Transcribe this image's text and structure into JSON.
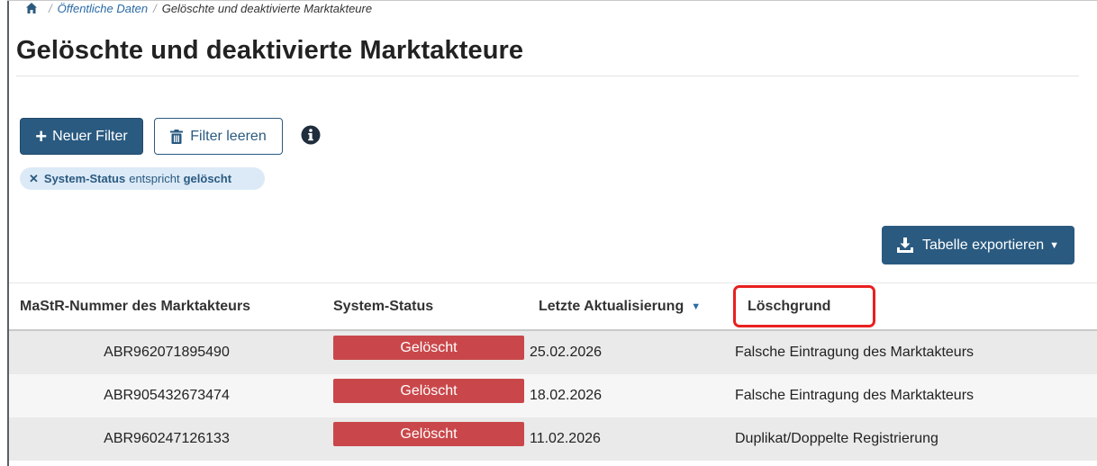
{
  "breadcrumb": {
    "home_icon": "home-icon",
    "items": [
      "Öffentliche Daten",
      "Gelöschte und deaktivierte Marktakteure"
    ]
  },
  "page": {
    "title": "Gelöschte und deaktivierte Marktakteure"
  },
  "toolbar": {
    "new_filter_label": "Neuer Filter",
    "clear_filter_label": "Filter leeren",
    "info_icon": "info-icon"
  },
  "active_filter": {
    "field": "System-Status",
    "operator": "entspricht",
    "value": "gelöscht"
  },
  "export": {
    "label": "Tabelle exportieren"
  },
  "table": {
    "columns": [
      "MaStR-Nummer des Marktakteurs",
      "System-Status",
      "Letzte Aktualisierung",
      "Löschgrund"
    ],
    "sort_column": "Letzte Aktualisierung",
    "sort_direction": "descending",
    "rows": [
      {
        "nummer": "ABR962071895490",
        "status": "Gelöscht",
        "datum": "25.02.2026",
        "grund": "Falsche Eintragung des Marktakteurs"
      },
      {
        "nummer": "ABR905432673474",
        "status": "Gelöscht",
        "datum": "18.02.2026",
        "grund": "Falsche Eintragung des Marktakteurs"
      },
      {
        "nummer": "ABR960247126133",
        "status": "Gelöscht",
        "datum": "11.02.2026",
        "grund": "Duplikat/Doppelte Registrierung"
      }
    ]
  },
  "colors": {
    "primary": "#2a5a80",
    "status_deleted": "#c9474a",
    "highlight": "#e8201f",
    "chip_bg": "#dceaf7"
  }
}
